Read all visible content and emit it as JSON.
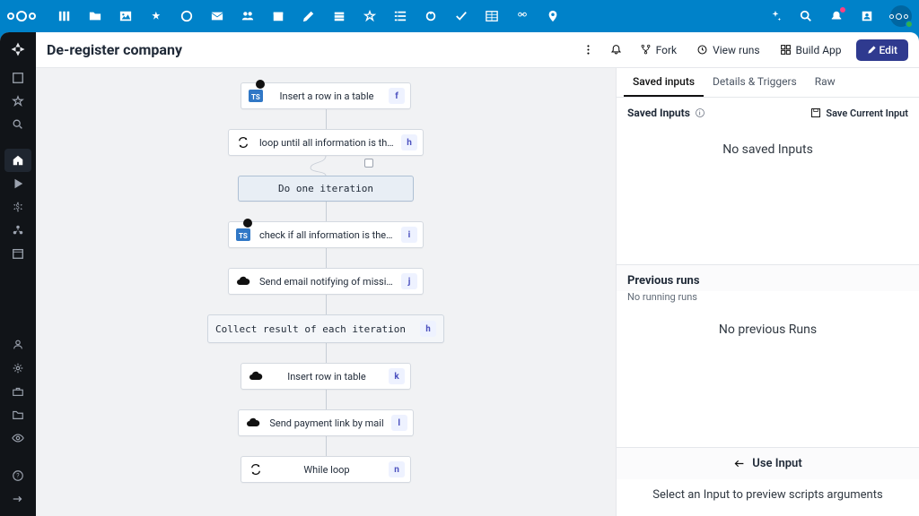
{
  "header": {
    "title": "De-register company"
  },
  "actions": {
    "fork": "Fork",
    "view_runs": "View runs",
    "build_app": "Build App",
    "edit": "Edit"
  },
  "tabs": {
    "saved_inputs": "Saved inputs",
    "details": "Details & Triggers",
    "raw": "Raw"
  },
  "panel": {
    "saved_inputs_label": "Saved Inputs",
    "save_current": "Save Current Input",
    "no_saved": "No saved Inputs",
    "prev_runs_label": "Previous runs",
    "no_running": "No running runs",
    "no_prev": "No previous Runs",
    "use_input": "Use Input",
    "preview_hint": "Select an Input to preview scripts arguments"
  },
  "nodes": {
    "n1": {
      "label": "Insert a row in a table",
      "key": "f"
    },
    "n2": {
      "label": "loop until all information is there",
      "key": "h"
    },
    "iter": {
      "label": "Do one iteration"
    },
    "n3": {
      "label": "check if all information is there",
      "key": "i"
    },
    "n4": {
      "label": "Send email notifying of missing infor...",
      "key": "j"
    },
    "collect": {
      "label": "Collect result of each iteration",
      "key": "h"
    },
    "n5": {
      "label": "Insert row in table",
      "key": "k"
    },
    "n6": {
      "label": "Send payment link by mail",
      "key": "l"
    },
    "n7": {
      "label": "While loop",
      "key": "n"
    }
  }
}
